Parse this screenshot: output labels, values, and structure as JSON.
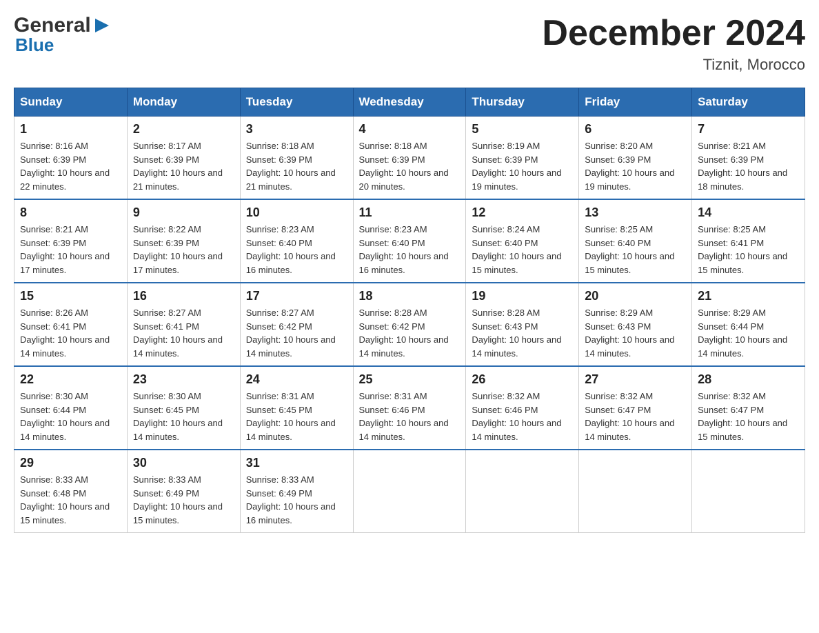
{
  "logo": {
    "text_general": "General",
    "text_blue": "Blue",
    "triangle_color": "#1a6faf"
  },
  "title": "December 2024",
  "subtitle": "Tiznit, Morocco",
  "header_color": "#2b6cb0",
  "days_of_week": [
    "Sunday",
    "Monday",
    "Tuesday",
    "Wednesday",
    "Thursday",
    "Friday",
    "Saturday"
  ],
  "weeks": [
    [
      {
        "day": "1",
        "sunrise": "Sunrise: 8:16 AM",
        "sunset": "Sunset: 6:39 PM",
        "daylight": "Daylight: 10 hours and 22 minutes."
      },
      {
        "day": "2",
        "sunrise": "Sunrise: 8:17 AM",
        "sunset": "Sunset: 6:39 PM",
        "daylight": "Daylight: 10 hours and 21 minutes."
      },
      {
        "day": "3",
        "sunrise": "Sunrise: 8:18 AM",
        "sunset": "Sunset: 6:39 PM",
        "daylight": "Daylight: 10 hours and 21 minutes."
      },
      {
        "day": "4",
        "sunrise": "Sunrise: 8:18 AM",
        "sunset": "Sunset: 6:39 PM",
        "daylight": "Daylight: 10 hours and 20 minutes."
      },
      {
        "day": "5",
        "sunrise": "Sunrise: 8:19 AM",
        "sunset": "Sunset: 6:39 PM",
        "daylight": "Daylight: 10 hours and 19 minutes."
      },
      {
        "day": "6",
        "sunrise": "Sunrise: 8:20 AM",
        "sunset": "Sunset: 6:39 PM",
        "daylight": "Daylight: 10 hours and 19 minutes."
      },
      {
        "day": "7",
        "sunrise": "Sunrise: 8:21 AM",
        "sunset": "Sunset: 6:39 PM",
        "daylight": "Daylight: 10 hours and 18 minutes."
      }
    ],
    [
      {
        "day": "8",
        "sunrise": "Sunrise: 8:21 AM",
        "sunset": "Sunset: 6:39 PM",
        "daylight": "Daylight: 10 hours and 17 minutes."
      },
      {
        "day": "9",
        "sunrise": "Sunrise: 8:22 AM",
        "sunset": "Sunset: 6:39 PM",
        "daylight": "Daylight: 10 hours and 17 minutes."
      },
      {
        "day": "10",
        "sunrise": "Sunrise: 8:23 AM",
        "sunset": "Sunset: 6:40 PM",
        "daylight": "Daylight: 10 hours and 16 minutes."
      },
      {
        "day": "11",
        "sunrise": "Sunrise: 8:23 AM",
        "sunset": "Sunset: 6:40 PM",
        "daylight": "Daylight: 10 hours and 16 minutes."
      },
      {
        "day": "12",
        "sunrise": "Sunrise: 8:24 AM",
        "sunset": "Sunset: 6:40 PM",
        "daylight": "Daylight: 10 hours and 15 minutes."
      },
      {
        "day": "13",
        "sunrise": "Sunrise: 8:25 AM",
        "sunset": "Sunset: 6:40 PM",
        "daylight": "Daylight: 10 hours and 15 minutes."
      },
      {
        "day": "14",
        "sunrise": "Sunrise: 8:25 AM",
        "sunset": "Sunset: 6:41 PM",
        "daylight": "Daylight: 10 hours and 15 minutes."
      }
    ],
    [
      {
        "day": "15",
        "sunrise": "Sunrise: 8:26 AM",
        "sunset": "Sunset: 6:41 PM",
        "daylight": "Daylight: 10 hours and 14 minutes."
      },
      {
        "day": "16",
        "sunrise": "Sunrise: 8:27 AM",
        "sunset": "Sunset: 6:41 PM",
        "daylight": "Daylight: 10 hours and 14 minutes."
      },
      {
        "day": "17",
        "sunrise": "Sunrise: 8:27 AM",
        "sunset": "Sunset: 6:42 PM",
        "daylight": "Daylight: 10 hours and 14 minutes."
      },
      {
        "day": "18",
        "sunrise": "Sunrise: 8:28 AM",
        "sunset": "Sunset: 6:42 PM",
        "daylight": "Daylight: 10 hours and 14 minutes."
      },
      {
        "day": "19",
        "sunrise": "Sunrise: 8:28 AM",
        "sunset": "Sunset: 6:43 PM",
        "daylight": "Daylight: 10 hours and 14 minutes."
      },
      {
        "day": "20",
        "sunrise": "Sunrise: 8:29 AM",
        "sunset": "Sunset: 6:43 PM",
        "daylight": "Daylight: 10 hours and 14 minutes."
      },
      {
        "day": "21",
        "sunrise": "Sunrise: 8:29 AM",
        "sunset": "Sunset: 6:44 PM",
        "daylight": "Daylight: 10 hours and 14 minutes."
      }
    ],
    [
      {
        "day": "22",
        "sunrise": "Sunrise: 8:30 AM",
        "sunset": "Sunset: 6:44 PM",
        "daylight": "Daylight: 10 hours and 14 minutes."
      },
      {
        "day": "23",
        "sunrise": "Sunrise: 8:30 AM",
        "sunset": "Sunset: 6:45 PM",
        "daylight": "Daylight: 10 hours and 14 minutes."
      },
      {
        "day": "24",
        "sunrise": "Sunrise: 8:31 AM",
        "sunset": "Sunset: 6:45 PM",
        "daylight": "Daylight: 10 hours and 14 minutes."
      },
      {
        "day": "25",
        "sunrise": "Sunrise: 8:31 AM",
        "sunset": "Sunset: 6:46 PM",
        "daylight": "Daylight: 10 hours and 14 minutes."
      },
      {
        "day": "26",
        "sunrise": "Sunrise: 8:32 AM",
        "sunset": "Sunset: 6:46 PM",
        "daylight": "Daylight: 10 hours and 14 minutes."
      },
      {
        "day": "27",
        "sunrise": "Sunrise: 8:32 AM",
        "sunset": "Sunset: 6:47 PM",
        "daylight": "Daylight: 10 hours and 14 minutes."
      },
      {
        "day": "28",
        "sunrise": "Sunrise: 8:32 AM",
        "sunset": "Sunset: 6:47 PM",
        "daylight": "Daylight: 10 hours and 15 minutes."
      }
    ],
    [
      {
        "day": "29",
        "sunrise": "Sunrise: 8:33 AM",
        "sunset": "Sunset: 6:48 PM",
        "daylight": "Daylight: 10 hours and 15 minutes."
      },
      {
        "day": "30",
        "sunrise": "Sunrise: 8:33 AM",
        "sunset": "Sunset: 6:49 PM",
        "daylight": "Daylight: 10 hours and 15 minutes."
      },
      {
        "day": "31",
        "sunrise": "Sunrise: 8:33 AM",
        "sunset": "Sunset: 6:49 PM",
        "daylight": "Daylight: 10 hours and 16 minutes."
      },
      null,
      null,
      null,
      null
    ]
  ]
}
